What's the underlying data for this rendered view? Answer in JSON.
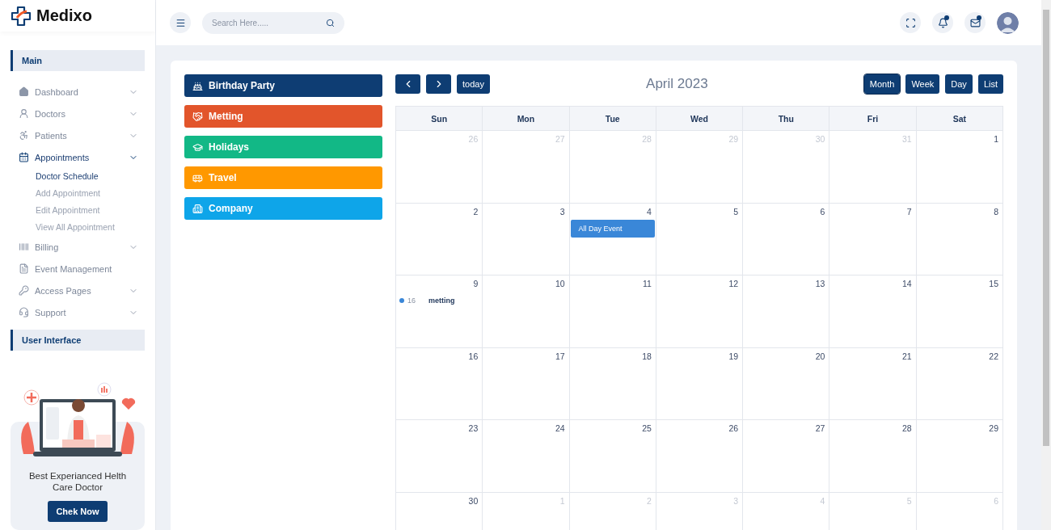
{
  "brand": {
    "name": "Medixo"
  },
  "sidebar": {
    "sections": [
      {
        "title": "Main",
        "items": [
          {
            "label": "Dashboard",
            "has_arrow": true,
            "selected": false
          },
          {
            "label": "Doctors",
            "has_arrow": true,
            "selected": false
          },
          {
            "label": "Patients",
            "has_arrow": true,
            "selected": false
          },
          {
            "label": "Appointments",
            "has_arrow": true,
            "selected": true,
            "children": [
              {
                "label": "Doctor Schedule",
                "selected": true
              },
              {
                "label": "Add Appointment",
                "selected": false
              },
              {
                "label": "Edit Appointment",
                "selected": false
              },
              {
                "label": "View All Appointment",
                "selected": false
              }
            ]
          },
          {
            "label": "Billing",
            "has_arrow": true,
            "selected": false
          },
          {
            "label": "Event Management",
            "has_arrow": false,
            "selected": false
          },
          {
            "label": "Access Pages",
            "has_arrow": true,
            "selected": false
          },
          {
            "label": "Support",
            "has_arrow": true,
            "selected": false
          }
        ]
      },
      {
        "title": "User Interface"
      }
    ],
    "promo": {
      "text": "Best Experianced Helth Care Doctor",
      "button": "Chek Now"
    }
  },
  "header": {
    "search": {
      "placeholder": "Search Here....."
    },
    "notifications": {
      "unread": true
    },
    "messages": {
      "unread": true
    }
  },
  "event_types": [
    {
      "label": "Birthday Party",
      "color": "#0e3d73"
    },
    {
      "label": "Metting",
      "color": "#e2552b"
    },
    {
      "label": "Holidays",
      "color": "#12b886"
    },
    {
      "label": "Travel",
      "color": "#ff9800"
    },
    {
      "label": "Company",
      "color": "#0ea5e9"
    }
  ],
  "calendar": {
    "title": "April 2023",
    "today_button": "today",
    "views": [
      {
        "label": "Month",
        "selected": true
      },
      {
        "label": "Week",
        "selected": false
      },
      {
        "label": "Day",
        "selected": false
      },
      {
        "label": "List",
        "selected": false
      }
    ],
    "weekdays": [
      "Sun",
      "Mon",
      "Tue",
      "Wed",
      "Thu",
      "Fri",
      "Sat"
    ],
    "weeks": [
      [
        {
          "day": "26",
          "other_month": true
        },
        {
          "day": "27",
          "other_month": true
        },
        {
          "day": "28",
          "other_month": true
        },
        {
          "day": "29",
          "other_month": true
        },
        {
          "day": "30",
          "other_month": true
        },
        {
          "day": "31",
          "other_month": true
        },
        {
          "day": "1",
          "other_month": false
        }
      ],
      [
        {
          "day": "2",
          "other_month": false
        },
        {
          "day": "3",
          "other_month": false
        },
        {
          "day": "4",
          "other_month": false,
          "events": [
            {
              "kind": "block",
              "title": "All Day Event"
            }
          ]
        },
        {
          "day": "5",
          "other_month": false
        },
        {
          "day": "6",
          "other_month": false
        },
        {
          "day": "7",
          "other_month": false
        },
        {
          "day": "8",
          "other_month": false
        }
      ],
      [
        {
          "day": "9",
          "other_month": false,
          "events": [
            {
              "kind": "dot",
              "time": "16",
              "title": "metting"
            }
          ]
        },
        {
          "day": "10",
          "other_month": false
        },
        {
          "day": "11",
          "other_month": false
        },
        {
          "day": "12",
          "other_month": false
        },
        {
          "day": "13",
          "other_month": false
        },
        {
          "day": "14",
          "other_month": false
        },
        {
          "day": "15",
          "other_month": false
        }
      ],
      [
        {
          "day": "16",
          "other_month": false
        },
        {
          "day": "17",
          "other_month": false
        },
        {
          "day": "18",
          "other_month": false
        },
        {
          "day": "19",
          "other_month": false
        },
        {
          "day": "20",
          "other_month": false
        },
        {
          "day": "21",
          "other_month": false
        },
        {
          "day": "22",
          "other_month": false
        }
      ],
      [
        {
          "day": "23",
          "other_month": false
        },
        {
          "day": "24",
          "other_month": false
        },
        {
          "day": "25",
          "other_month": false
        },
        {
          "day": "26",
          "other_month": false
        },
        {
          "day": "27",
          "other_month": false
        },
        {
          "day": "28",
          "other_month": false
        },
        {
          "day": "29",
          "other_month": false
        }
      ],
      [
        {
          "day": "30",
          "other_month": false
        },
        {
          "day": "1",
          "other_month": true
        },
        {
          "day": "2",
          "other_month": true
        },
        {
          "day": "3",
          "other_month": true
        },
        {
          "day": "4",
          "other_month": true
        },
        {
          "day": "5",
          "other_month": true
        },
        {
          "day": "6",
          "other_month": true
        }
      ]
    ]
  }
}
